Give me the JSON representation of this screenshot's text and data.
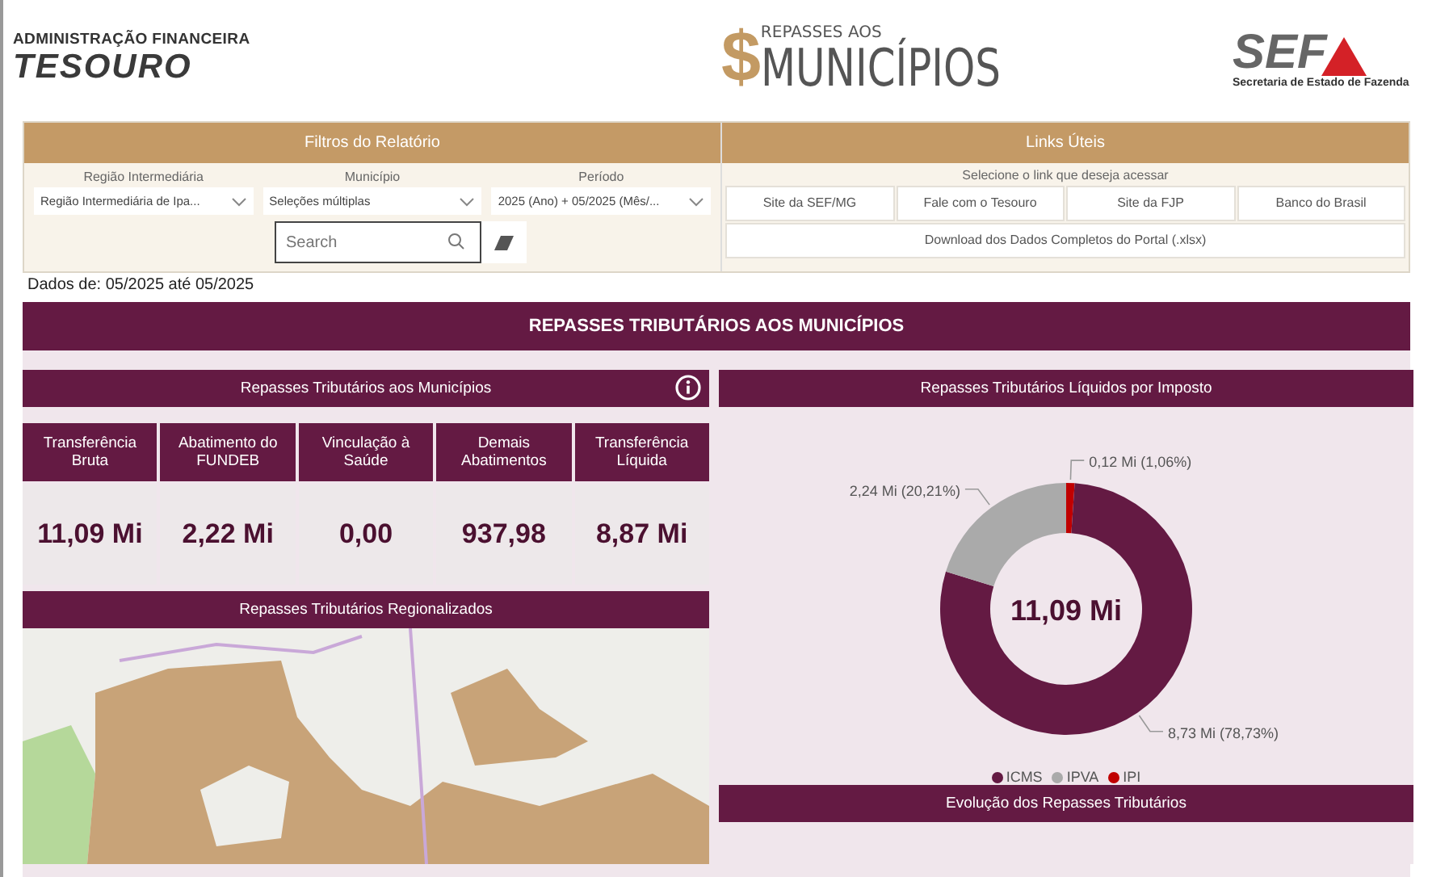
{
  "header": {
    "org_label": "ADMINISTRAÇÃO FINANCEIRA",
    "org_name": "TESOURO",
    "title_small": "REPASSES AOS",
    "dollar": "$",
    "title_large": "MUNICÍPIOS",
    "sef_logo": "SEF",
    "sef_caption": "Secretaria de Estado de Fazenda"
  },
  "filters": {
    "title": "Filtros do Relatório",
    "dropdowns": [
      {
        "label": "Região Intermediária",
        "value": "Região Intermediária de Ipa..."
      },
      {
        "label": "Município",
        "value": "Seleções múltiplas"
      },
      {
        "label": "Período",
        "value": "2025 (Ano) + 05/2025 (Mês/..."
      }
    ],
    "search": {
      "placeholder": "Search"
    }
  },
  "links": {
    "title": "Links Úteis",
    "prompt": "Selecione o link que deseja acessar",
    "buttons": [
      "Site da SEF/MG",
      "Fale com o Tesouro",
      "Site da FJP",
      "Banco do Brasil"
    ],
    "download": "Download dos Dados Completos do Portal (.xlsx)"
  },
  "date_range": "Dados de: 05/2025 até 05/2025",
  "main_title": "REPASSES TRIBUTÁRIOS AOS MUNICÍPIOS",
  "summary": {
    "title": "Repasses Tributários aos Municípios",
    "kpis": [
      {
        "label": "Transferência Bruta",
        "value": "11,09 Mi"
      },
      {
        "label": "Abatimento do FUNDEB",
        "value": "2,22 Mi"
      },
      {
        "label": "Vinculação à Saúde",
        "value": "0,00"
      },
      {
        "label": "Demais Abatimentos",
        "value": "937,98"
      },
      {
        "label": "Transferência Líquida",
        "value": "8,87 Mi"
      }
    ]
  },
  "map": {
    "title": "Repasses Tributários Regionalizados"
  },
  "tax_chart": {
    "title": "Repasses Tributários Líquidos por Imposto",
    "center_value": "11,09 Mi",
    "chart_data": {
      "type": "donut",
      "categories": [
        "ICMS",
        "IPVA",
        "IPI"
      ],
      "values": [
        8.73,
        2.24,
        0.12
      ],
      "colors": [
        "#641a43",
        "#aaaaaa",
        "#c00000"
      ],
      "data_labels": true,
      "legend": "bottom",
      "value_labels": [
        "8,73 Mi (78,73%)",
        "2,24 Mi (20,21%)",
        "0,12 Mi (1,06%)"
      ]
    }
  },
  "evolution": {
    "title": "Evolução dos Repasses Tributários"
  }
}
